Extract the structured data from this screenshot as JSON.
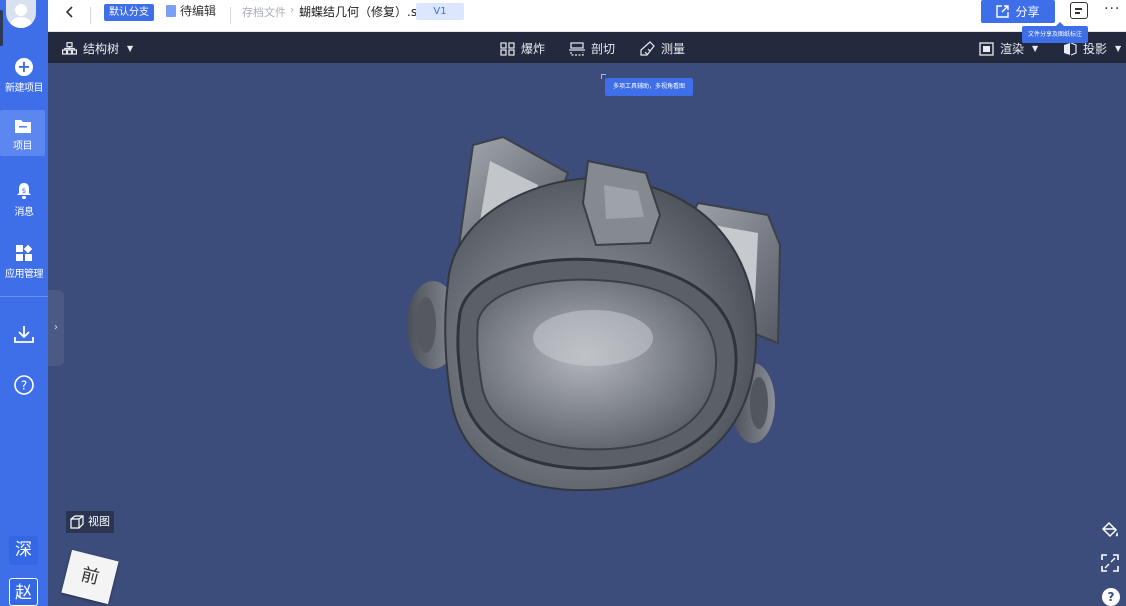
{
  "sidebar": {
    "items": [
      {
        "label": "新建项目",
        "icon": "plus-circle-icon"
      },
      {
        "label": "项目",
        "icon": "folder-icon"
      },
      {
        "label": "消息",
        "icon": "bell-icon"
      },
      {
        "label": "应用管理",
        "icon": "apps-grid-icon"
      }
    ],
    "download_icon": "download-icon",
    "help_icon": "help-icon",
    "user_tags": [
      "深",
      "赵"
    ]
  },
  "topbar": {
    "branch": "默认分支",
    "status": "待编辑",
    "breadcrumb_root": "存档文件",
    "breadcrumb_sep": "›",
    "filename": "蝴蝶结几何（修复）.stl",
    "version": "V1",
    "share_label": "分享",
    "share_tooltip": "文件分享及图纸标注",
    "more": "···"
  },
  "toolbar": {
    "tree_label": "结构树",
    "explode_label": "爆炸",
    "section_label": "剖切",
    "measure_label": "测量",
    "render_label": "渲染",
    "projection_label": "投影",
    "tools_tooltip": "多项工具辅助，多视角看图"
  },
  "viewport": {
    "view_label": "视图",
    "cube_face": "前",
    "help": "?"
  },
  "colors": {
    "accent": "#3f6fe8",
    "sidebar": "#3f6fe8",
    "toolbar": "#232a3d",
    "viewport_bg": "#3d4d7b"
  }
}
